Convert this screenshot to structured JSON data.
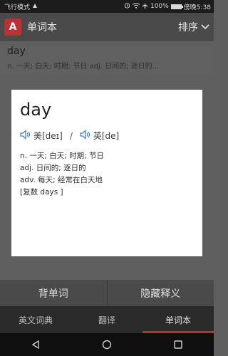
{
  "status": {
    "left": "飞行模式",
    "battery": "100%",
    "carrier": "傍晚5:38",
    "battery_level": 1.0
  },
  "app": {
    "icon_letter": "A",
    "title": "单词本",
    "sort_label": "排序"
  },
  "list": [
    {
      "word": "day",
      "definition": "n. 一天; 白天; 时期; 节日 adj. 日间的; 逐日的..."
    }
  ],
  "dialog": {
    "word": "day",
    "us_label": "美[deɪ]",
    "separator": "/",
    "uk_label": "英[de]",
    "definitions": [
      "n. 一天; 白天; 时期; 节日",
      "adj. 日间的; 逐日的",
      "adv. 每天; 经常在白天地",
      "[复数 days ]"
    ]
  },
  "actions": {
    "memorize": "背单词",
    "hide_meaning": "隐藏释义"
  },
  "tabs": [
    {
      "label": "英文词典"
    },
    {
      "label": "翻译"
    },
    {
      "label": "单词本",
      "active": true
    }
  ],
  "colors": {
    "accent": "#b83233",
    "overlay": "#5f5f5f"
  }
}
